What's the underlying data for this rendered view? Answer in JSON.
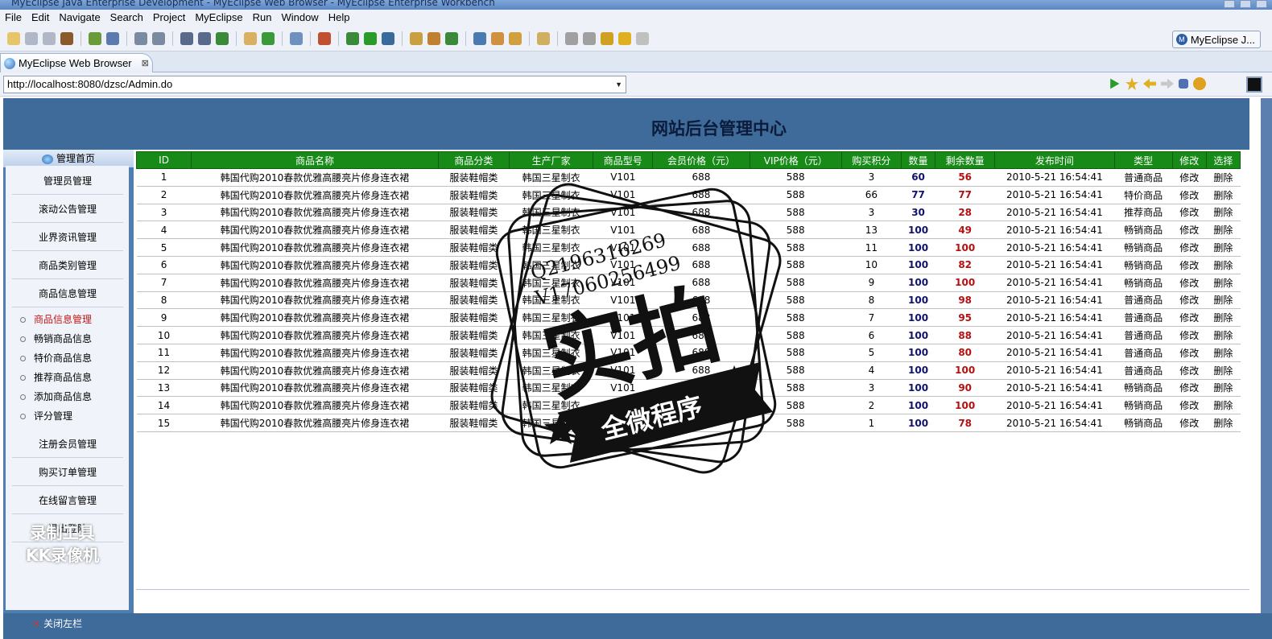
{
  "window": {
    "title": "MyEclipse Java Enterprise Development - MyEclipse Web Browser - MyEclipse Enterprise Workbench"
  },
  "menu": [
    "File",
    "Edit",
    "Navigate",
    "Search",
    "Project",
    "MyEclipse",
    "Run",
    "Window",
    "Help"
  ],
  "perspective": {
    "label": "MyEclipse J..."
  },
  "tab": {
    "label": "MyEclipse Web Browser",
    "close": "⊠"
  },
  "address": {
    "url": "http://localhost:8080/dzsc/Admin.do"
  },
  "header": {
    "title": "网站后台管理中心"
  },
  "sidebar": {
    "head": "管理首页",
    "groups": [
      "管理员管理",
      "滚动公告管理",
      "业界资讯管理",
      "商品类别管理",
      "商品信息管理"
    ],
    "items": [
      "商品信息管理",
      "畅销商品信息",
      "特价商品信息",
      "推荐商品信息",
      "添加商品信息",
      "评分管理"
    ],
    "groups2": [
      "注册会员管理",
      "购买订单管理",
      "在线留言管理",
      "退出登陆"
    ]
  },
  "colors": {
    "header_bg": "#3f6b9a",
    "table_head": "#178a17",
    "qty": "#11126a",
    "remaining": "#b41010",
    "active_item": "#c0181a"
  },
  "table": {
    "columns": [
      "ID",
      "商品名称",
      "商品分类",
      "生产厂家",
      "商品型号",
      "会员价格（元）",
      "VIP价格（元）",
      "购买积分",
      "数量",
      "剩余数量",
      "发布时间",
      "类型",
      "修改",
      "选择"
    ],
    "rows": [
      [
        "1",
        "韩国代购2010春款优雅高腰亮片修身连衣裙",
        "服装鞋帽类",
        "韩国三星制衣",
        "V101",
        "688",
        "588",
        "3",
        "60",
        "56",
        "2010-5-21 16:54:41",
        "普通商品",
        "修改",
        "删除"
      ],
      [
        "2",
        "韩国代购2010春款优雅高腰亮片修身连衣裙",
        "服装鞋帽类",
        "韩国三星制衣",
        "V101",
        "688",
        "588",
        "66",
        "77",
        "77",
        "2010-5-21 16:54:41",
        "特价商品",
        "修改",
        "删除"
      ],
      [
        "3",
        "韩国代购2010春款优雅高腰亮片修身连衣裙",
        "服装鞋帽类",
        "韩国三星制衣",
        "V101",
        "688",
        "588",
        "3",
        "30",
        "28",
        "2010-5-21 16:54:41",
        "推荐商品",
        "修改",
        "删除"
      ],
      [
        "4",
        "韩国代购2010春款优雅高腰亮片修身连衣裙",
        "服装鞋帽类",
        "韩国三星制衣",
        "V101",
        "688",
        "588",
        "13",
        "100",
        "49",
        "2010-5-21 16:54:41",
        "畅销商品",
        "修改",
        "删除"
      ],
      [
        "5",
        "韩国代购2010春款优雅高腰亮片修身连衣裙",
        "服装鞋帽类",
        "韩国三星制衣",
        "V101",
        "688",
        "588",
        "11",
        "100",
        "100",
        "2010-5-21 16:54:41",
        "畅销商品",
        "修改",
        "删除"
      ],
      [
        "6",
        "韩国代购2010春款优雅高腰亮片修身连衣裙",
        "服装鞋帽类",
        "韩国三星制衣",
        "V101",
        "688",
        "588",
        "10",
        "100",
        "82",
        "2010-5-21 16:54:41",
        "畅销商品",
        "修改",
        "删除"
      ],
      [
        "7",
        "韩国代购2010春款优雅高腰亮片修身连衣裙",
        "服装鞋帽类",
        "韩国三星制衣",
        "V101",
        "688",
        "588",
        "9",
        "100",
        "100",
        "2010-5-21 16:54:41",
        "畅销商品",
        "修改",
        "删除"
      ],
      [
        "8",
        "韩国代购2010春款优雅高腰亮片修身连衣裙",
        "服装鞋帽类",
        "韩国三星制衣",
        "V101",
        "688",
        "588",
        "8",
        "100",
        "98",
        "2010-5-21 16:54:41",
        "普通商品",
        "修改",
        "删除"
      ],
      [
        "9",
        "韩国代购2010春款优雅高腰亮片修身连衣裙",
        "服装鞋帽类",
        "韩国三星制衣",
        "V101",
        "688",
        "588",
        "7",
        "100",
        "95",
        "2010-5-21 16:54:41",
        "普通商品",
        "修改",
        "删除"
      ],
      [
        "10",
        "韩国代购2010春款优雅高腰亮片修身连衣裙",
        "服装鞋帽类",
        "韩国三星制衣",
        "V101",
        "688",
        "588",
        "6",
        "100",
        "88",
        "2010-5-21 16:54:41",
        "普通商品",
        "修改",
        "删除"
      ],
      [
        "11",
        "韩国代购2010春款优雅高腰亮片修身连衣裙",
        "服装鞋帽类",
        "韩国三星制衣",
        "V101",
        "688",
        "588",
        "5",
        "100",
        "80",
        "2010-5-21 16:54:41",
        "普通商品",
        "修改",
        "删除"
      ],
      [
        "12",
        "韩国代购2010春款优雅高腰亮片修身连衣裙",
        "服装鞋帽类",
        "韩国三星制衣",
        "V101",
        "688",
        "588",
        "4",
        "100",
        "100",
        "2010-5-21 16:54:41",
        "普通商品",
        "修改",
        "删除"
      ],
      [
        "13",
        "韩国代购2010春款优雅高腰亮片修身连衣裙",
        "服装鞋帽类",
        "韩国三星制衣",
        "V101",
        "688",
        "588",
        "3",
        "100",
        "90",
        "2010-5-21 16:54:41",
        "畅销商品",
        "修改",
        "删除"
      ],
      [
        "14",
        "韩国代购2010春款优雅高腰亮片修身连衣裙",
        "服装鞋帽类",
        "韩国三星制衣",
        "V101",
        "688",
        "588",
        "2",
        "100",
        "100",
        "2010-5-21 16:54:41",
        "畅销商品",
        "修改",
        "删除"
      ],
      [
        "15",
        "韩国代购2010春款优雅高腰亮片修身连衣裙",
        "服装鞋帽类",
        "韩国三星制衣",
        "V101",
        "688",
        "588",
        "1",
        "100",
        "78",
        "2010-5-21 16:54:41",
        "畅销商品",
        "修改",
        "删除"
      ]
    ]
  },
  "footer": {
    "label": "关闭左栏"
  },
  "watermark": {
    "line1": "录制工具",
    "line2": "KK录像机"
  },
  "stamp": {
    "phone1": "Q2196316269",
    "phone2": "V17060256499",
    "big": "实拍",
    "banner": "全微程序"
  }
}
